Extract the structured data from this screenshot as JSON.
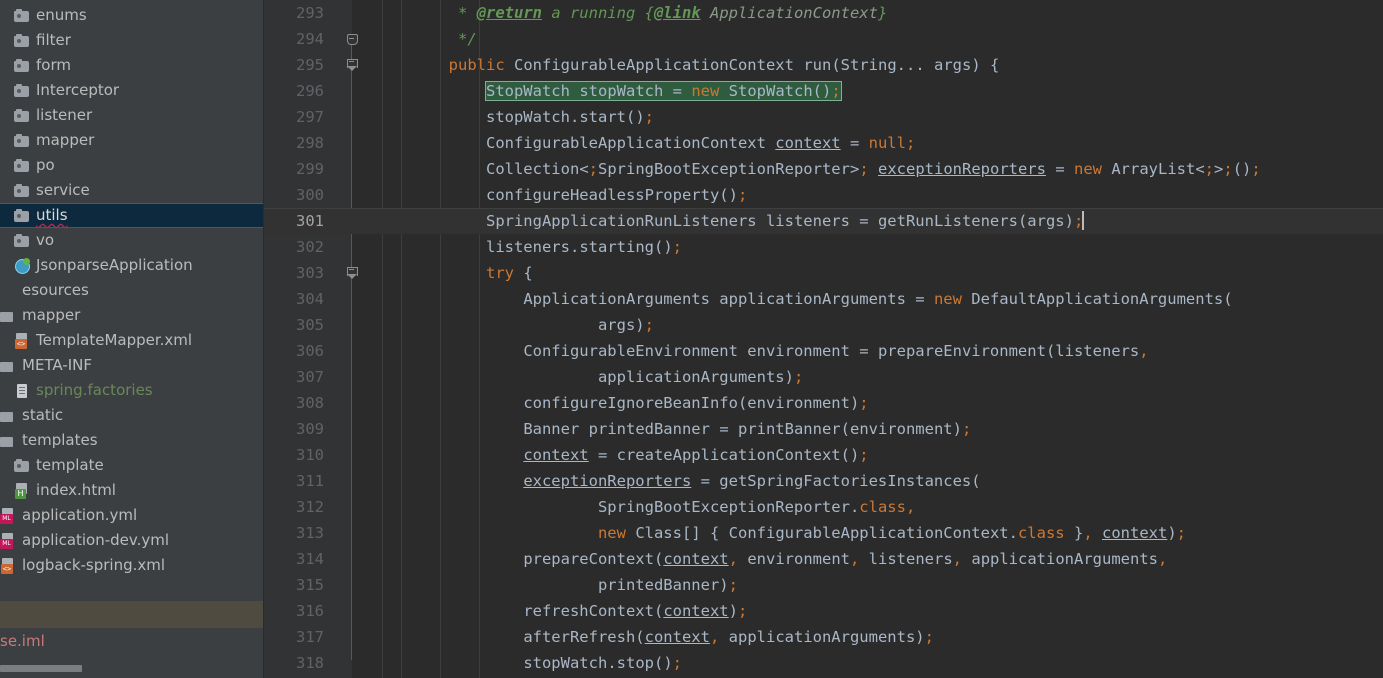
{
  "sidebar": {
    "tree": [
      {
        "label": "enums",
        "icon": "folder-icon",
        "indent": 14,
        "type": "folder"
      },
      {
        "label": "filter",
        "icon": "folder-icon",
        "indent": 14,
        "type": "folder"
      },
      {
        "label": "form",
        "icon": "folder-icon",
        "indent": 14,
        "type": "folder"
      },
      {
        "label": "Interceptor",
        "icon": "folder-icon",
        "indent": 14,
        "type": "folder"
      },
      {
        "label": "listener",
        "icon": "folder-icon",
        "indent": 14,
        "type": "folder"
      },
      {
        "label": "mapper",
        "icon": "folder-icon",
        "indent": 14,
        "type": "folder"
      },
      {
        "label": "po",
        "icon": "folder-icon",
        "indent": 14,
        "type": "folder"
      },
      {
        "label": "service",
        "icon": "folder-icon",
        "indent": 14,
        "type": "folder"
      },
      {
        "label": "utils",
        "icon": "folder-icon",
        "indent": 14,
        "type": "folder",
        "selected": true
      },
      {
        "label": "vo",
        "icon": "folder-icon",
        "indent": 14,
        "type": "folder"
      },
      {
        "label": "JsonparseApplication",
        "icon": "spring-boot-class-icon",
        "indent": 14,
        "type": "class"
      },
      {
        "label": "esources",
        "icon": "none",
        "indent": -8,
        "type": "source-folder"
      },
      {
        "label": "mapper",
        "icon": "source-folder-icon",
        "indent": -8,
        "type": "source-folder"
      },
      {
        "label": "TemplateMapper.xml",
        "icon": "xml-file-icon",
        "indent": 14,
        "type": "file"
      },
      {
        "label": "META-INF",
        "icon": "source-folder-icon",
        "indent": -8,
        "type": "source-folder"
      },
      {
        "label": "spring.factories",
        "icon": "text-file-icon",
        "indent": 14,
        "type": "file",
        "color": "green"
      },
      {
        "label": "static",
        "icon": "source-folder-icon",
        "indent": -8,
        "type": "source-folder"
      },
      {
        "label": "templates",
        "icon": "source-folder-icon",
        "indent": -8,
        "type": "source-folder"
      },
      {
        "label": "template",
        "icon": "folder-icon",
        "indent": 14,
        "type": "folder"
      },
      {
        "label": "index.html",
        "icon": "html-file-icon",
        "indent": 14,
        "type": "file"
      },
      {
        "label": "application.yml",
        "icon": "yml-file-icon",
        "indent": -8,
        "type": "file"
      },
      {
        "label": "application-dev.yml",
        "icon": "yml-file-icon",
        "indent": -8,
        "type": "file"
      },
      {
        "label": "logback-spring.xml",
        "icon": "xml-file-icon",
        "indent": -8,
        "type": "file"
      }
    ],
    "iml_row": {
      "label": "se.iml"
    },
    "scrollbar": {
      "name": "horizontal-scrollbar"
    }
  },
  "editor": {
    "first_line": 293,
    "caret_line": 301,
    "selection_line": 296,
    "selection_text": "StopWatch stopWatch = new StopWatch();",
    "lines": [
      {
        "n": 293,
        "text": "         * @return a running {@link ApplicationContext}"
      },
      {
        "n": 294,
        "text": "         */",
        "fold": "up"
      },
      {
        "n": 295,
        "text": "        public ConfigurableApplicationContext run(String... args) {",
        "fold": "down"
      },
      {
        "n": 296,
        "text": "            StopWatch stopWatch = new StopWatch();"
      },
      {
        "n": 297,
        "text": "            stopWatch.start();"
      },
      {
        "n": 298,
        "text": "            ConfigurableApplicationContext context = null;"
      },
      {
        "n": 299,
        "text": "            Collection<SpringBootExceptionReporter> exceptionReporters = new ArrayList<>();"
      },
      {
        "n": 300,
        "text": "            configureHeadlessProperty();"
      },
      {
        "n": 301,
        "text": "            SpringApplicationRunListeners listeners = getRunListeners(args);"
      },
      {
        "n": 302,
        "text": "            listeners.starting();"
      },
      {
        "n": 303,
        "text": "            try {",
        "fold": "down"
      },
      {
        "n": 304,
        "text": "                ApplicationArguments applicationArguments = new DefaultApplicationArguments("
      },
      {
        "n": 305,
        "text": "                        args);"
      },
      {
        "n": 306,
        "text": "                ConfigurableEnvironment environment = prepareEnvironment(listeners,"
      },
      {
        "n": 307,
        "text": "                        applicationArguments);"
      },
      {
        "n": 308,
        "text": "                configureIgnoreBeanInfo(environment);"
      },
      {
        "n": 309,
        "text": "                Banner printedBanner = printBanner(environment);"
      },
      {
        "n": 310,
        "text": "                context = createApplicationContext();"
      },
      {
        "n": 311,
        "text": "                exceptionReporters = getSpringFactoriesInstances("
      },
      {
        "n": 312,
        "text": "                        SpringBootExceptionReporter.class,"
      },
      {
        "n": 313,
        "text": "                        new Class[] { ConfigurableApplicationContext.class }, context);"
      },
      {
        "n": 314,
        "text": "                prepareContext(context, environment, listeners, applicationArguments,"
      },
      {
        "n": 315,
        "text": "                        printedBanner);"
      },
      {
        "n": 316,
        "text": "                refreshContext(context);"
      },
      {
        "n": 317,
        "text": "                afterRefresh(context, applicationArguments);"
      },
      {
        "n": 318,
        "text": "                stopWatch.stop();"
      }
    ]
  },
  "colors": {
    "editor_background": "#2b2b2b",
    "gutter_background": "#313335",
    "sidebar_background": "#3c3f41",
    "selection_highlight": "#2f5c3f",
    "selection_border": "#7fb08f",
    "tree_selection": "#0d293e",
    "keyword": "#cc7832",
    "default_text": "#a9b7c6",
    "comment": "#629755",
    "caret_row": "#323232",
    "band": "#4f4b41"
  }
}
